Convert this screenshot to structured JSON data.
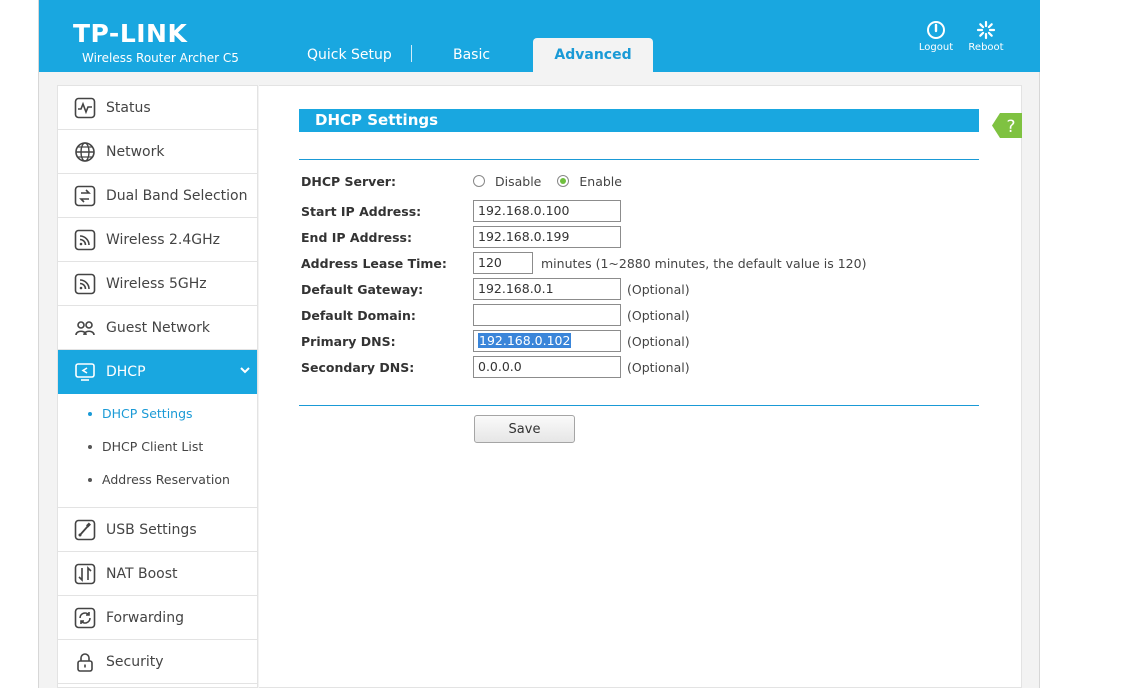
{
  "header": {
    "logo": "TP-LINK",
    "model": "Wireless Router Archer C5",
    "tabs": [
      {
        "label": "Quick Setup"
      },
      {
        "label": "Basic"
      },
      {
        "label": "Advanced"
      }
    ],
    "logout_label": "Logout",
    "reboot_label": "Reboot",
    "accent_color": "#19a7e0"
  },
  "sidebar": {
    "items": [
      {
        "label": "Status",
        "icon": "status-icon"
      },
      {
        "label": "Network",
        "icon": "globe-icon"
      },
      {
        "label": "Dual Band Selection",
        "icon": "dual-band-icon"
      },
      {
        "label": "Wireless 2.4GHz",
        "icon": "wireless-icon"
      },
      {
        "label": "Wireless 5GHz",
        "icon": "wireless-icon"
      },
      {
        "label": "Guest Network",
        "icon": "guest-icon"
      },
      {
        "label": "DHCP",
        "icon": "dhcp-icon"
      },
      {
        "label": "USB Settings",
        "icon": "usb-icon"
      },
      {
        "label": "NAT Boost",
        "icon": "nat-boost-icon"
      },
      {
        "label": "Forwarding",
        "icon": "forwarding-icon"
      },
      {
        "label": "Security",
        "icon": "lock-icon"
      }
    ],
    "dhcp_sub": [
      {
        "label": "DHCP Settings"
      },
      {
        "label": "DHCP Client List"
      },
      {
        "label": "Address Reservation"
      }
    ]
  },
  "content": {
    "title": "DHCP Settings",
    "help_label": "?",
    "server": {
      "label": "DHCP Server:",
      "options": [
        "Disable",
        "Enable"
      ],
      "selected": "Enable"
    },
    "start_ip": {
      "label": "Start IP Address:",
      "value": "192.168.0.100"
    },
    "end_ip": {
      "label": "End IP Address:",
      "value": "192.168.0.199"
    },
    "lease": {
      "label": "Address Lease Time:",
      "value": "120",
      "hint": "minutes (1~2880 minutes, the default value is 120)"
    },
    "gateway": {
      "label": "Default Gateway:",
      "value": "192.168.0.1",
      "optional": "(Optional)"
    },
    "domain": {
      "label": "Default Domain:",
      "value": "",
      "optional": "(Optional)"
    },
    "primary_dns": {
      "label": "Primary DNS:",
      "value": "192.168.0.102",
      "optional": "(Optional)"
    },
    "secondary_dns": {
      "label": "Secondary DNS:",
      "value": "0.0.0.0",
      "optional": "(Optional)"
    },
    "save_label": "Save"
  }
}
